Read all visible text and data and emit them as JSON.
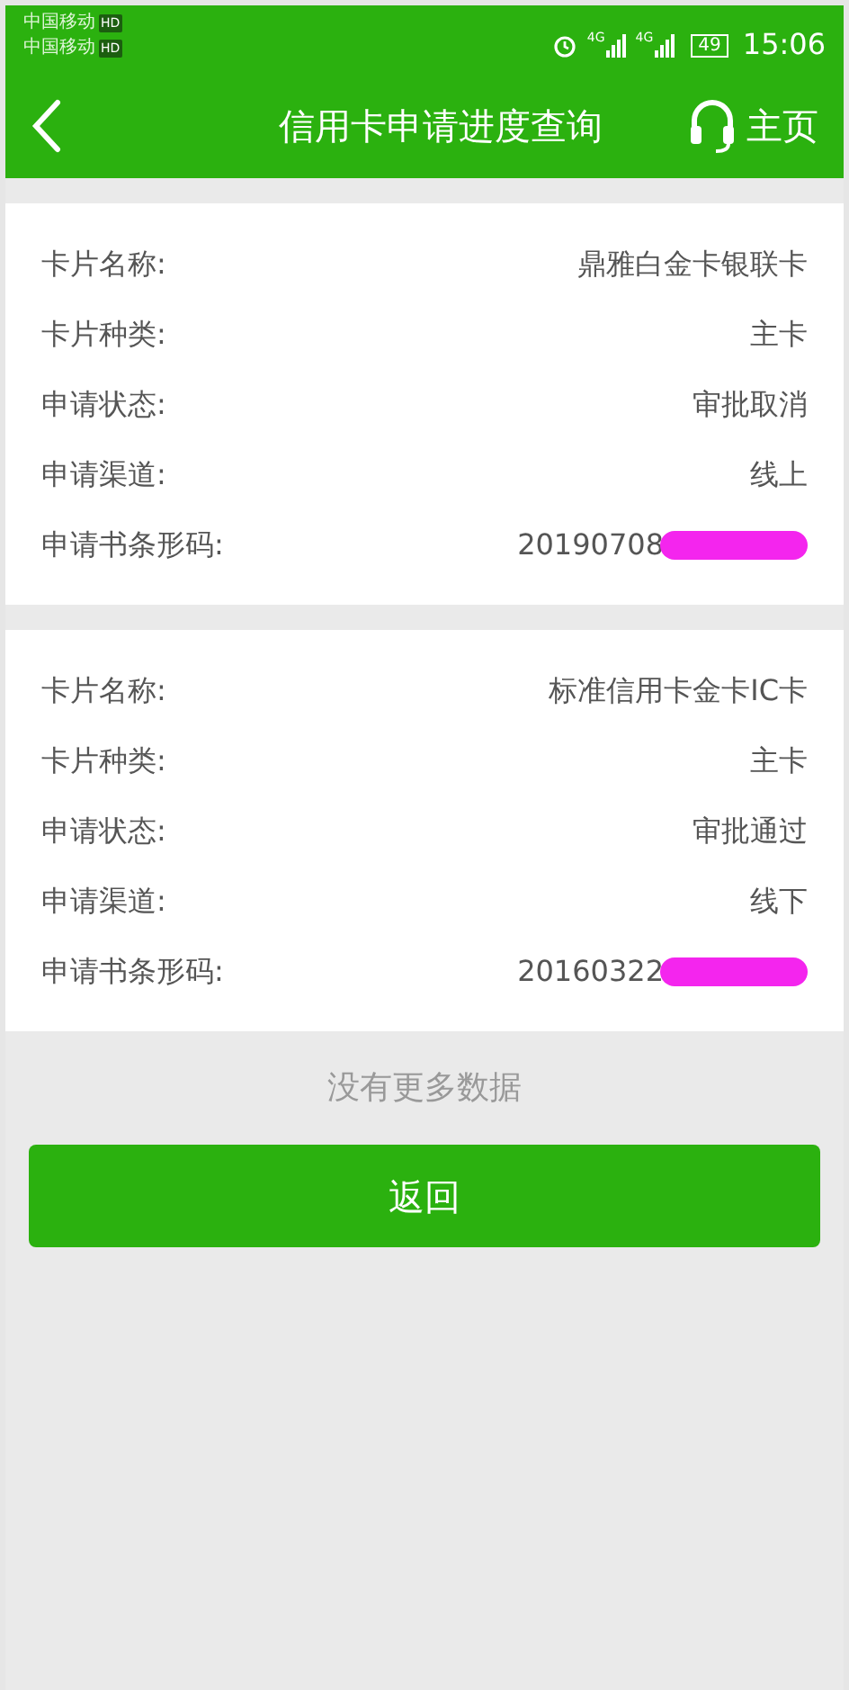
{
  "status_bar": {
    "carriers": [
      {
        "name": "中国移动",
        "badge": "HD"
      },
      {
        "name": "中国移动",
        "badge": "HD"
      }
    ],
    "networks": [
      "4G",
      "4G"
    ],
    "battery": "49",
    "time": "15:06"
  },
  "header": {
    "title": "信用卡申请进度查询",
    "home": "主页"
  },
  "cards": [
    {
      "fields": [
        {
          "label": "卡片名称:",
          "value": "鼎雅白金卡银联卡",
          "redacted": false
        },
        {
          "label": "卡片种类:",
          "value": "主卡",
          "redacted": false
        },
        {
          "label": "申请状态:",
          "value": "审批取消",
          "redacted": false
        },
        {
          "label": "申请渠道:",
          "value": "线上",
          "redacted": false
        },
        {
          "label": "申请书条形码:",
          "value": "20190708",
          "redacted": true
        }
      ]
    },
    {
      "fields": [
        {
          "label": "卡片名称:",
          "value": "标准信用卡金卡IC卡",
          "redacted": false
        },
        {
          "label": "卡片种类:",
          "value": "主卡",
          "redacted": false
        },
        {
          "label": "申请状态:",
          "value": "审批通过",
          "redacted": false
        },
        {
          "label": "申请渠道:",
          "value": "线下",
          "redacted": false
        },
        {
          "label": "申请书条形码:",
          "value": "20160322",
          "redacted": true
        }
      ]
    }
  ],
  "footer_note": "没有更多数据",
  "back_button": "返回"
}
